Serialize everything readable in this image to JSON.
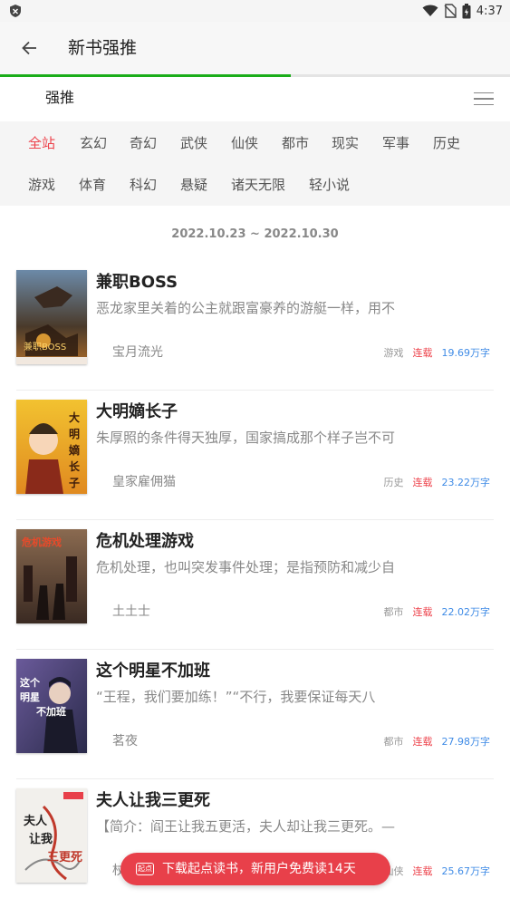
{
  "status_bar": {
    "time": "4:37",
    "icons": [
      "shield-icon",
      "wifi-icon",
      "no-sim-icon",
      "battery-icon"
    ]
  },
  "app_bar": {
    "back_icon": "arrow-left-icon",
    "title": "新书强推"
  },
  "progress": {
    "fraction": 0.57,
    "color": "#1aad19"
  },
  "tab": {
    "label": "强推",
    "menu_icon": "menu-icon"
  },
  "categories": {
    "row1": [
      "全站",
      "玄幻",
      "奇幻",
      "武侠",
      "仙侠",
      "都市",
      "现实",
      "军事",
      "历史"
    ],
    "row2": [
      "游戏",
      "体育",
      "科幻",
      "悬疑",
      "诸天无限",
      "轻小说"
    ],
    "active": "全站",
    "active_color": "#ed424b"
  },
  "date_range": "2022.10.23 ~ 2022.10.30",
  "books": [
    {
      "title": "兼职BOSS",
      "description": "恶龙家里关着的公主就跟富豪养的游艇一样，用不",
      "author": "宝月流光",
      "genre": "游戏",
      "status": "连载",
      "word_count": "19.69万字",
      "cover_text": "兼职BOSS"
    },
    {
      "title": "大明嫡长子",
      "description": "朱厚照的条件得天独厚，国家搞成那个样子岂不可",
      "author": "皇家雇佣猫",
      "genre": "历史",
      "status": "连载",
      "word_count": "23.22万字",
      "cover_text": "大明嫡长子"
    },
    {
      "title": "危机处理游戏",
      "description": "危机处理，也叫突发事件处理；是指预防和减少自",
      "author": "土土士",
      "genre": "都市",
      "status": "连载",
      "word_count": "22.02万字",
      "cover_text": "危机游戏"
    },
    {
      "title": "这个明星不加班",
      "description": "“王程，我们要加练！”“不行，我要保证每天八",
      "author": "茗夜",
      "genre": "都市",
      "status": "连载",
      "word_count": "27.98万字",
      "cover_text": "这个明星不加班"
    },
    {
      "title": "夫人让我三更死",
      "description": "【简介：阎王让我五更活，夫人却让我三更死。—",
      "author": "杖",
      "genre": "仙侠",
      "status": "连载",
      "word_count": "25.67万字",
      "cover_text": "夫人让我三更死"
    }
  ],
  "download_banner": {
    "logo_text": "起点",
    "text": "下载起点读书，新用户免费读14天",
    "color": "#e8404a"
  }
}
